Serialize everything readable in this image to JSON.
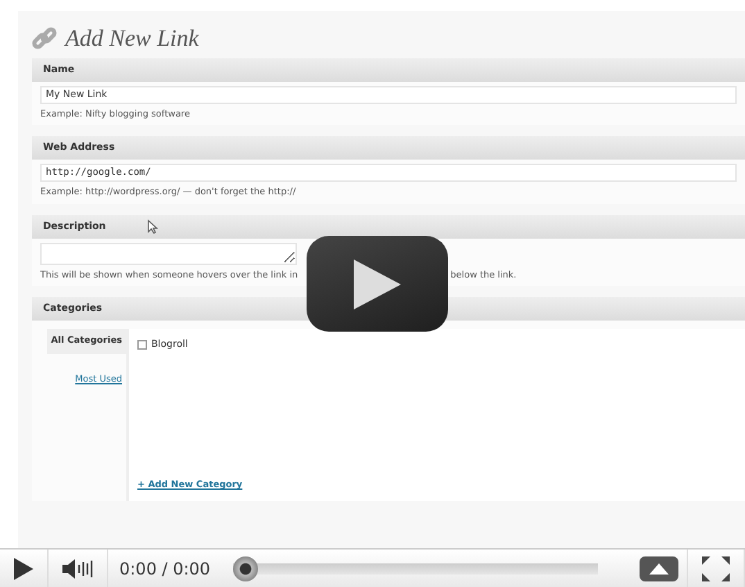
{
  "heading": "Add New Link",
  "sections": [
    {
      "kind": "input",
      "title": "Name",
      "value": "My New Link",
      "notes": [
        "Example: Nifty blogging software"
      ]
    },
    {
      "kind": "input",
      "title": "Web Address",
      "value": "http://google.com/",
      "notes": [
        "Example: http://wordpress.org/ — don't forget the http://"
      ]
    },
    {
      "kind": "textarea",
      "title": "Description",
      "notes": [
        "This will be shown when someone hovers over the link in",
        "below the link."
      ]
    }
  ],
  "categories": {
    "title": "Categories",
    "tabs": [
      {
        "label": "All Categories",
        "selected": true
      },
      {
        "label": "Most Used",
        "selected": false
      }
    ],
    "items": [
      {
        "label": "Blogroll",
        "checked": false
      }
    ],
    "add_link": "+ Add New Category"
  },
  "player": {
    "time": "0:00 / 0:00",
    "level": 0
  }
}
